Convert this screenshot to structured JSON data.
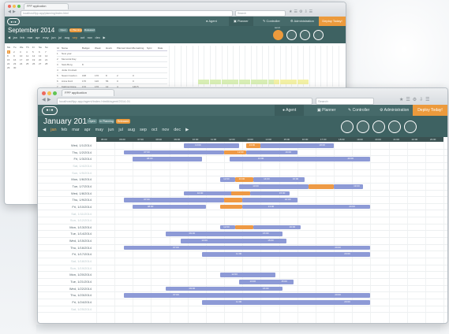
{
  "colors": {
    "nav": "#466a6a",
    "subbar": "#3e6262",
    "accent": "#ec9a3c",
    "bar": "#8d9ad6",
    "bar_highlight": "#ee9a45",
    "weekend_label": "#b9c8cc"
  },
  "back_window": {
    "tab_label": "FPP application",
    "url": "localhost/fpp-app/planning/index.html",
    "search_placeholder": "Search",
    "nav": {
      "agent": "Agent",
      "planner": "Planner",
      "controller": "Controller",
      "administration": "Administration",
      "cta": "Deploy Today!"
    },
    "title": "September 2014",
    "pills": [
      {
        "label": "Open"
      },
      {
        "label": "In Planning"
      },
      {
        "label": "Released"
      }
    ],
    "months": [
      "jan",
      "feb",
      "mar",
      "apr",
      "may",
      "jun",
      "jul",
      "aug",
      "sep",
      "oct",
      "nov",
      "dec"
    ],
    "current_month_index": 8,
    "send_label": "send",
    "minical_header": [
      "Mo",
      "Tu",
      "We",
      "Th",
      "Fr",
      "Sa",
      "Su"
    ],
    "minical_days": [
      "1",
      "2",
      "3",
      "4",
      "5",
      "6",
      "7",
      "8",
      "9",
      "10",
      "11",
      "12",
      "13",
      "14",
      "15",
      "16",
      "17",
      "18",
      "19",
      "20",
      "21",
      "22",
      "23",
      "24",
      "25",
      "26",
      "27",
      "28",
      "29",
      "30"
    ],
    "table_headers": [
      "Id",
      "Name",
      "Budget",
      "Week",
      "Hours",
      "Planned Hours",
      "Remaining",
      "Sync",
      "Date"
    ],
    "table_rows": [
      {
        "id": "1",
        "name": "New year",
        "cells": [
          "",
          "",
          "",
          "",
          "",
          "",
          ""
        ]
      },
      {
        "id": "2",
        "name": "Memorial Day",
        "cells": [
          "",
          "",
          "",
          "",
          "",
          "",
          ""
        ]
      },
      {
        "id": "3",
        "name": "Sara Burg",
        "cells": [
          "8",
          "",
          "",
          "",
          "",
          "",
          ""
        ]
      },
      {
        "id": "4",
        "name": "Jodie Crockett",
        "cells": [
          "",
          "",
          "",
          "",
          "",
          "",
          ""
        ]
      },
      {
        "id": "5",
        "name": "Naomi Gordon",
        "cells": [
          "168",
          "176",
          "8",
          "2",
          "0",
          "",
          ""
        ]
      },
      {
        "id": "6",
        "name": "Anna Ford",
        "cells": [
          "176",
          "120",
          "56",
          "0",
          "0",
          "",
          ""
        ]
      },
      {
        "id": "7",
        "name": "Katrina Crane",
        "cells": [
          "172",
          "176",
          "12",
          "4",
          "146.5",
          "",
          ""
        ]
      }
    ]
  },
  "front_window": {
    "tab_label": "FPP application",
    "url": "localhost/fpp-app/agent/index.html#/agent/2014-01",
    "search_placeholder": "Search",
    "nav": {
      "agent": "Agent",
      "planner": "Planner",
      "controller": "Controller",
      "administration": "Administration",
      "cta": "Deploy Today!"
    },
    "title": "January 2014",
    "pills": [
      {
        "label": "Open"
      },
      {
        "label": "In Planning"
      },
      {
        "label": "Released"
      }
    ],
    "months": [
      "jan",
      "feb",
      "mar",
      "apr",
      "may",
      "jun",
      "jul",
      "aug",
      "sep",
      "oct",
      "nov",
      "dec"
    ],
    "current_month_index": 0,
    "hours": [
      "05:00",
      "06:00",
      "07:00",
      "08:00",
      "09:00",
      "10:00",
      "11:00",
      "12:00",
      "13:00",
      "14:00",
      "15:00",
      "16:00",
      "17:00",
      "18:00",
      "19:00",
      "20:00",
      "21:00",
      "22:00",
      "23:00"
    ],
    "days": [
      {
        "label": "Wed, 1/1/2014",
        "weekend": false,
        "bars": [
          {
            "s": 9.8,
            "e": 12.8,
            "t": "10:00",
            "t2": ""
          },
          {
            "s": 13.2,
            "e": 14.0,
            "t": "13:00",
            "t2": "",
            "o": true
          },
          {
            "s": 14.0,
            "e": 18.0,
            "t": "",
            "t2": "18:00"
          }
        ]
      },
      {
        "label": "Thu, 1/2/2014",
        "weekend": false,
        "bars": [
          {
            "s": 6.5,
            "e": 12.0,
            "t": "07:00",
            "t2": ""
          },
          {
            "s": 12.0,
            "e": 13.2,
            "t": "",
            "t2": "12:00",
            "o": true
          },
          {
            "s": 13.2,
            "e": 16.0,
            "t": "",
            "t2": "16:00"
          }
        ]
      },
      {
        "label": "Fri, 1/3/2014",
        "weekend": false,
        "bars": [
          {
            "s": 7.0,
            "e": 10.8,
            "t": "08:00",
            "t2": ""
          },
          {
            "s": 12.3,
            "e": 20.0,
            "t": "13:00",
            "t2": "20:00"
          }
        ]
      },
      {
        "label": "Sat, 1/4/2014",
        "weekend": true,
        "bars": []
      },
      {
        "label": "Sun, 1/5/2014",
        "weekend": true,
        "bars": []
      },
      {
        "label": "Mon, 1/6/2014",
        "weekend": false,
        "bars": [
          {
            "s": 11.8,
            "e": 12.6,
            "t": "12:00",
            "t2": ""
          },
          {
            "s": 12.6,
            "e": 13.6,
            "t": "13:00",
            "t2": "",
            "o": true
          },
          {
            "s": 13.6,
            "e": 16.4,
            "t": "14:00",
            "t2": "16:00"
          }
        ]
      },
      {
        "label": "Tue, 1/7/2014",
        "weekend": false,
        "bars": [
          {
            "s": 12.8,
            "e": 16.6,
            "t": "13:00",
            "t2": ""
          },
          {
            "s": 16.6,
            "e": 18.0,
            "t": "",
            "t2": "",
            "o": true
          },
          {
            "s": 18.0,
            "e": 19.6,
            "t": "",
            "t2": "19:00"
          }
        ]
      },
      {
        "label": "Wed, 1/8/2014",
        "weekend": false,
        "bars": [
          {
            "s": 9.8,
            "e": 13.4,
            "t": "10:00",
            "t2": ""
          },
          {
            "s": 12.4,
            "e": 13.4,
            "t": "",
            "t2": "",
            "o": true
          },
          {
            "s": 13.4,
            "e": 15.6,
            "t": "",
            "t2": "15:00"
          }
        ]
      },
      {
        "label": "Thu, 1/9/2014",
        "weekend": false,
        "bars": [
          {
            "s": 6.5,
            "e": 12.0,
            "t": "07:00",
            "t2": ""
          },
          {
            "s": 12.0,
            "e": 13.0,
            "t": "",
            "t2": "",
            "o": true
          },
          {
            "s": 13.0,
            "e": 16.0,
            "t": "",
            "t2": "16:00"
          }
        ]
      },
      {
        "label": "Fri, 1/10/2014",
        "weekend": false,
        "bars": [
          {
            "s": 7.0,
            "e": 11.0,
            "t": "08:00",
            "t2": ""
          },
          {
            "s": 11.8,
            "e": 13.0,
            "t": "",
            "t2": "",
            "o": true
          },
          {
            "s": 13.0,
            "e": 20.0,
            "t": "13:00",
            "t2": "20:00"
          }
        ]
      },
      {
        "label": "Sat, 1/11/2014",
        "weekend": true,
        "bars": []
      },
      {
        "label": "Sun, 1/12/2014",
        "weekend": true,
        "bars": []
      },
      {
        "label": "Mon, 1/13/2014",
        "weekend": false,
        "bars": [
          {
            "s": 11.8,
            "e": 12.6,
            "t": "12:00",
            "t2": ""
          },
          {
            "s": 12.6,
            "e": 13.6,
            "t": "",
            "t2": "",
            "o": true
          },
          {
            "s": 13.6,
            "e": 16.2,
            "t": "",
            "t2": "16:00"
          }
        ]
      },
      {
        "label": "Tue, 1/14/2014",
        "weekend": false,
        "bars": [
          {
            "s": 8.8,
            "e": 15.2,
            "t": "09:00",
            "t2": "15:00"
          }
        ]
      },
      {
        "label": "Wed, 1/15/2014",
        "weekend": false,
        "bars": [
          {
            "s": 9.6,
            "e": 15.4,
            "t": "10:00",
            "t2": "15:00"
          }
        ]
      },
      {
        "label": "Thu, 1/16/2014",
        "weekend": false,
        "bars": [
          {
            "s": 6.5,
            "e": 20.0,
            "t": "07:00",
            "t2": "20:00"
          }
        ]
      },
      {
        "label": "Fri, 1/17/2014",
        "weekend": false,
        "bars": [
          {
            "s": 10.8,
            "e": 20.0,
            "t": "11:00",
            "t2": "20:00"
          }
        ]
      },
      {
        "label": "Sat, 1/18/2014",
        "weekend": true,
        "bars": []
      },
      {
        "label": "Sun, 1/19/2014",
        "weekend": true,
        "bars": []
      },
      {
        "label": "Mon, 1/20/2014",
        "weekend": false,
        "bars": [
          {
            "s": 11.8,
            "e": 14.8,
            "t": "12:00",
            "t2": ""
          }
        ]
      },
      {
        "label": "Tue, 1/21/2014",
        "weekend": false,
        "bars": [
          {
            "s": 12.8,
            "e": 15.8,
            "t": "13:00",
            "t2": "15:00"
          }
        ]
      },
      {
        "label": "Wed, 1/22/2014",
        "weekend": false,
        "bars": [
          {
            "s": 8.8,
            "e": 15.2,
            "t": "09:00",
            "t2": "15:00"
          }
        ]
      },
      {
        "label": "Thu, 1/23/2014",
        "weekend": false,
        "bars": [
          {
            "s": 6.5,
            "e": 20.0,
            "t": "07:00",
            "t2": "20:00"
          }
        ]
      },
      {
        "label": "Fri, 1/24/2014",
        "weekend": false,
        "bars": [
          {
            "s": 10.8,
            "e": 20.0,
            "t": "11:00",
            "t2": "20:00"
          }
        ]
      },
      {
        "label": "Sat, 1/25/2014",
        "weekend": true,
        "bars": []
      }
    ]
  }
}
